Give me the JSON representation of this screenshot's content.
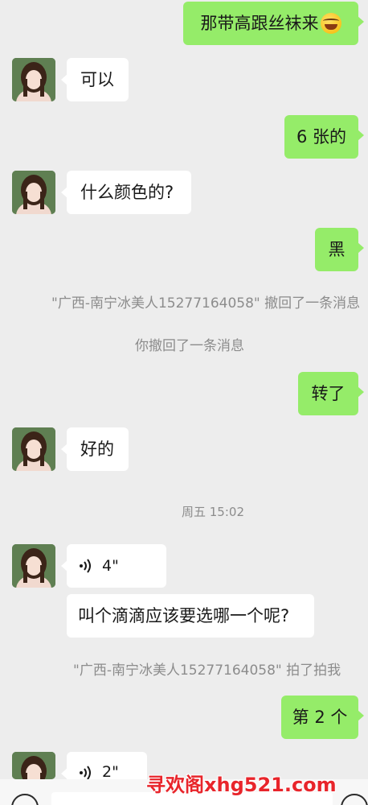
{
  "messages": [
    {
      "side": "me",
      "text": "那带高跟丝袜来"
    },
    {
      "side": "them",
      "text": "可以"
    },
    {
      "side": "me",
      "text": "6 张的"
    },
    {
      "side": "them",
      "text": "什么颜色的?"
    },
    {
      "side": "me",
      "text": "黑"
    },
    {
      "side": "me",
      "text": "转了"
    },
    {
      "side": "them",
      "text": "好的"
    },
    {
      "side": "them",
      "type": "voice",
      "duration": "4\""
    },
    {
      "side": "them",
      "text": "叫个滴滴应该要选哪一个呢?"
    },
    {
      "side": "me",
      "text": "第 2 个"
    },
    {
      "side": "them",
      "type": "voice",
      "duration": "2\""
    }
  ],
  "system": {
    "recall_other": "\"广西-南宁冰美人15277164058\" 撤回了一条消息",
    "recall_self": "你撤回了一条消息",
    "timestamp": "周五 15:02",
    "pat": "\"广西-南宁冰美人15277164058\" 拍了拍我"
  },
  "watermark": "寻欢阁xhg521.com",
  "colors": {
    "me_bubble": "#95ec69",
    "them_bubble": "#ffffff",
    "background": "#ededed",
    "watermark": "#e8252b"
  },
  "icons": {
    "voice": "voice-wave-icon",
    "laugh_emoji": "rolling-laughing-emoji-icon",
    "voice_input": "voice-input-icon",
    "emoji_button": "smiley-icon"
  }
}
